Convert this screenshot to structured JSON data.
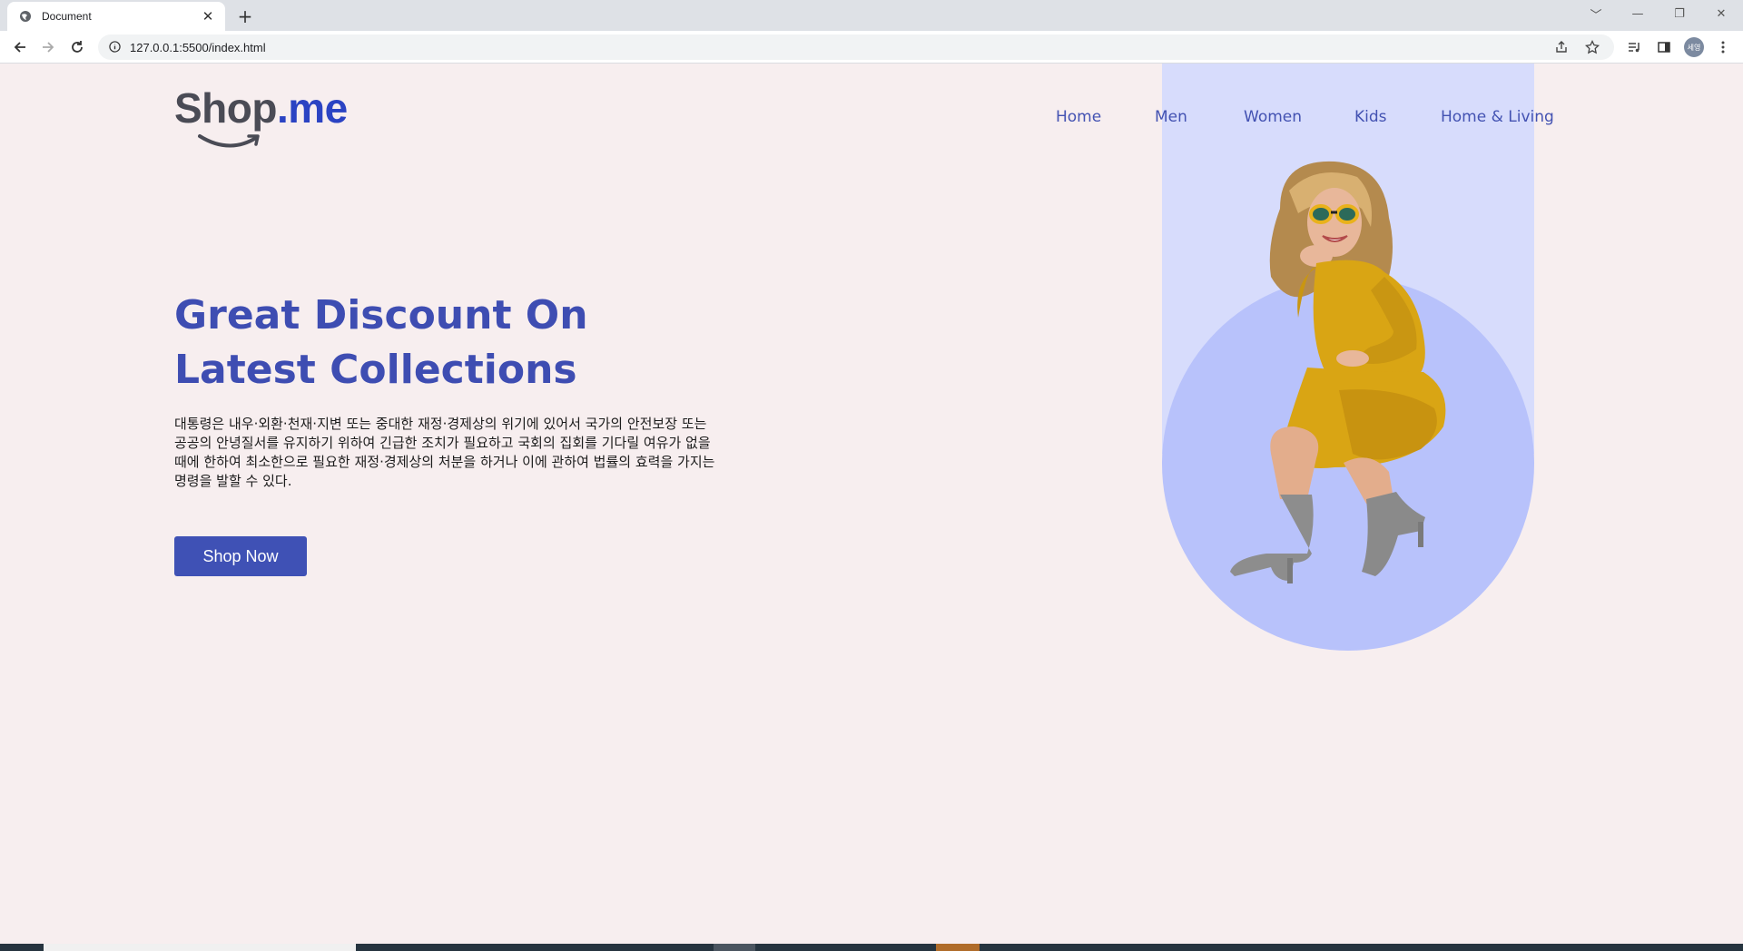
{
  "browser": {
    "tab_title": "Document",
    "tab_close_glyph": "✕",
    "new_tab_glyph": "+",
    "url": "127.0.0.1:5500/index.html",
    "profile_label": "세영",
    "window_controls": [
      "﹀",
      "—",
      "❐",
      "✕"
    ]
  },
  "page": {
    "logo": {
      "text_dark": "Shop",
      "text_accent": ".me",
      "accent_color": "#2b43c3"
    },
    "nav": [
      "Home",
      "Men",
      "Women",
      "Kids",
      "Home & Living"
    ],
    "hero": {
      "title": "Great Discount On Latest Collections",
      "description": "대통령은 내우·외환·천재·지변 또는 중대한 재정·경제상의 위기에 있어서 국가의 안전보장 또는 공공의 안녕질서를 유지하기 위하여 긴급한 조치가 필요하고 국회의 집회를 기다릴 여유가 없을 때에 한하여 최소한으로 필요한 재정·경제상의 처분을 하거나 이에 관하여 법률의 효력을 가지는 명령을 발할 수 있다.",
      "button": "Shop Now"
    },
    "colors": {
      "background": "#f7eeef",
      "primary": "#3f51b5",
      "hero_rect": "#d7dcfc",
      "hero_circle": "#b8c2fb",
      "dress": "#d9a514"
    }
  }
}
